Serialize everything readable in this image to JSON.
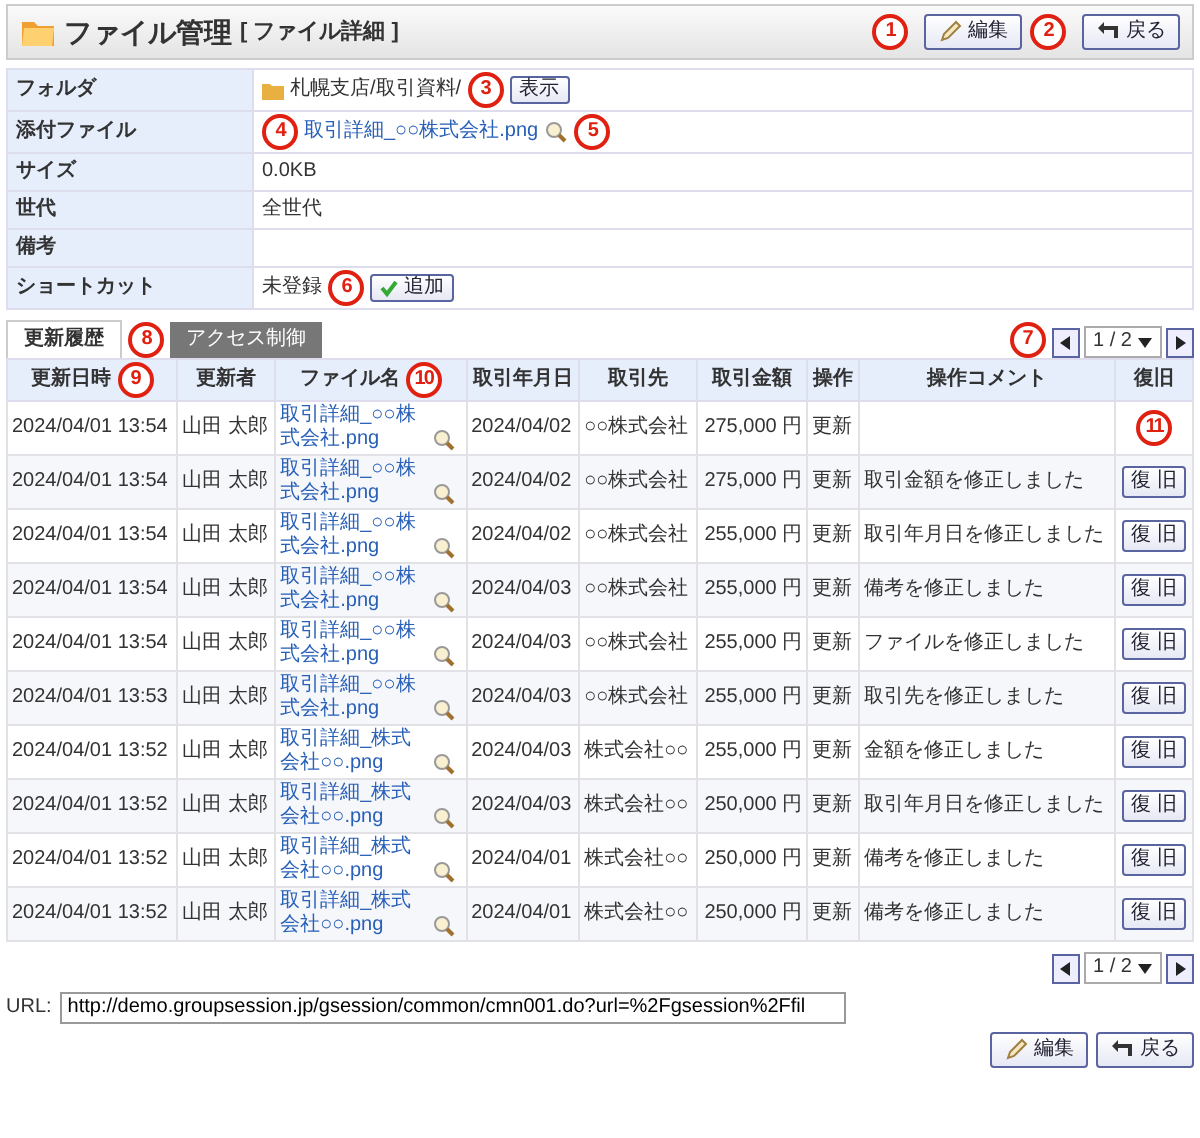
{
  "header": {
    "title": "ファイル管理",
    "subtitle": "[ ファイル詳細 ]",
    "buttons": [
      {
        "kind": "edit",
        "label": "編集"
      },
      {
        "kind": "back",
        "label": "戻る"
      }
    ]
  },
  "details": [
    {
      "kind": "folder",
      "label": "フォルダ",
      "value": "札幌支店/取引資料/",
      "button": "表示"
    },
    {
      "kind": "file",
      "label": "添付ファイル",
      "value": "取引詳細_○○株式会社.png"
    },
    {
      "kind": "text",
      "label": "サイズ",
      "value": "0.0KB"
    },
    {
      "kind": "text",
      "label": "世代",
      "value": "全世代"
    },
    {
      "kind": "text",
      "label": "備考"
    },
    {
      "kind": "shortcut",
      "label": "ショートカット",
      "value": "未登録",
      "button": "追加"
    }
  ],
  "tabs": [
    {
      "label": "更新履歴",
      "selected": true
    },
    {
      "label": "アクセス制御",
      "selected": false
    }
  ],
  "pager_top": {
    "value": "1 / 2"
  },
  "history": {
    "columns": [
      "更新日時",
      "更新者",
      "ファイル名",
      "取引年月日",
      "取引先",
      "取引金額",
      "操作",
      "操作コメント",
      "復旧"
    ],
    "rows": [
      {
        "datetime": "2024/04/01 13:54",
        "user": "山田 太郎",
        "file": "取引詳細_○○株式会社.png",
        "date": "2024/04/02",
        "partner": "○○株式会社",
        "amount": "275,000 円",
        "operation": "更新"
      },
      {
        "datetime": "2024/04/01 13:54",
        "user": "山田 太郎",
        "file": "取引詳細_○○株式会社.png",
        "date": "2024/04/02",
        "partner": "○○株式会社",
        "amount": "275,000 円",
        "operation": "更新",
        "comment": "取引金額を修正しました",
        "restore": "復 旧"
      },
      {
        "datetime": "2024/04/01 13:54",
        "user": "山田 太郎",
        "file": "取引詳細_○○株式会社.png",
        "date": "2024/04/02",
        "partner": "○○株式会社",
        "amount": "255,000 円",
        "operation": "更新",
        "comment": "取引年月日を修正しました",
        "restore": "復 旧"
      },
      {
        "datetime": "2024/04/01 13:54",
        "user": "山田 太郎",
        "file": "取引詳細_○○株式会社.png",
        "date": "2024/04/03",
        "partner": "○○株式会社",
        "amount": "255,000 円",
        "operation": "更新",
        "comment": "備考を修正しました",
        "restore": "復 旧"
      },
      {
        "datetime": "2024/04/01 13:54",
        "user": "山田 太郎",
        "file": "取引詳細_○○株式会社.png",
        "date": "2024/04/03",
        "partner": "○○株式会社",
        "amount": "255,000 円",
        "operation": "更新",
        "comment": "ファイルを修正しました",
        "restore": "復 旧"
      },
      {
        "datetime": "2024/04/01 13:53",
        "user": "山田 太郎",
        "file": "取引詳細_○○株式会社.png",
        "date": "2024/04/03",
        "partner": "○○株式会社",
        "amount": "255,000 円",
        "operation": "更新",
        "comment": "取引先を修正しました",
        "restore": "復 旧"
      },
      {
        "datetime": "2024/04/01 13:52",
        "user": "山田 太郎",
        "file": "取引詳細_株式会社○○.png",
        "date": "2024/04/03",
        "partner": "株式会社○○",
        "amount": "255,000 円",
        "operation": "更新",
        "comment": "金額を修正しました",
        "restore": "復 旧"
      },
      {
        "datetime": "2024/04/01 13:52",
        "user": "山田 太郎",
        "file": "取引詳細_株式会社○○.png",
        "date": "2024/04/03",
        "partner": "株式会社○○",
        "amount": "250,000 円",
        "operation": "更新",
        "comment": "取引年月日を修正しました",
        "restore": "復 旧"
      },
      {
        "datetime": "2024/04/01 13:52",
        "user": "山田 太郎",
        "file": "取引詳細_株式会社○○.png",
        "date": "2024/04/01",
        "partner": "株式会社○○",
        "amount": "250,000 円",
        "operation": "更新",
        "comment": "備考を修正しました",
        "restore": "復 旧"
      },
      {
        "datetime": "2024/04/01 13:52",
        "user": "山田 太郎",
        "file": "取引詳細_株式会社○○.png",
        "date": "2024/04/01",
        "partner": "株式会社○○",
        "amount": "250,000 円",
        "operation": "更新",
        "comment": "備考を修正しました",
        "restore": "復 旧"
      }
    ]
  },
  "pager_bottom": {
    "value": "1 / 2"
  },
  "url": {
    "label": "URL:",
    "value": "http://demo.groupsession.jp/gsession/common/cmn001.do?url=%2Fgsession%2Ffil"
  },
  "footer_buttons": [
    {
      "kind": "edit",
      "label": "編集"
    },
    {
      "kind": "back",
      "label": "戻る"
    }
  ],
  "callouts": [
    "1",
    "2",
    "3",
    "4",
    "5",
    "6",
    "7",
    "8",
    "9",
    "10",
    "11"
  ]
}
